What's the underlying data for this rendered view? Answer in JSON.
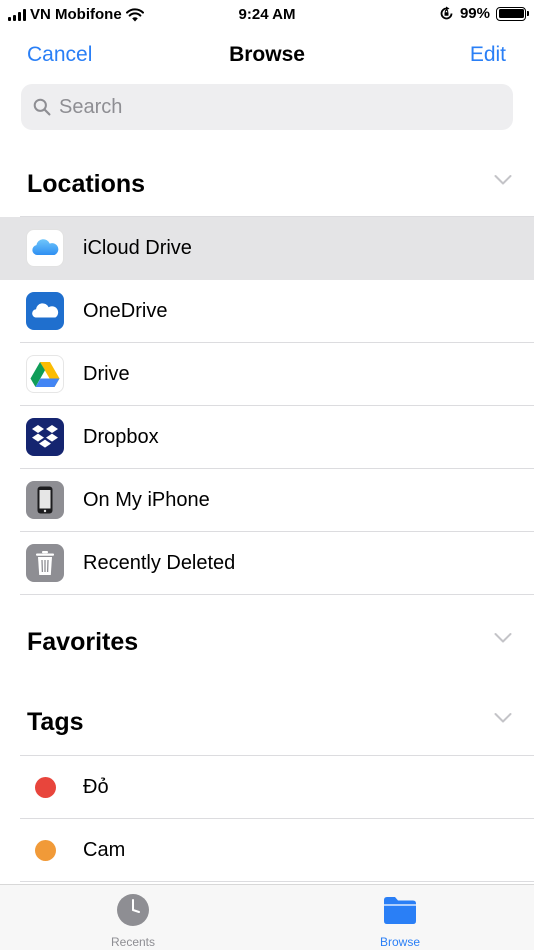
{
  "status_bar": {
    "carrier": "VN Mobifone",
    "time": "9:24 AM",
    "battery": "99%"
  },
  "nav": {
    "cancel_label": "Cancel",
    "title": "Browse",
    "edit_label": "Edit"
  },
  "search": {
    "placeholder": "Search"
  },
  "locations": {
    "title": "Locations",
    "items": [
      {
        "label": "iCloud Drive",
        "icon": "icloud-drive-icon",
        "selected": true
      },
      {
        "label": "OneDrive",
        "icon": "onedrive-icon"
      },
      {
        "label": "Drive",
        "icon": "google-drive-icon"
      },
      {
        "label": "Dropbox",
        "icon": "dropbox-icon"
      },
      {
        "label": "On My iPhone",
        "icon": "iphone-icon"
      },
      {
        "label": "Recently Deleted",
        "icon": "trash-icon"
      }
    ]
  },
  "favorites": {
    "title": "Favorites"
  },
  "tags": {
    "title": "Tags",
    "items": [
      {
        "label": "Đỏ",
        "color": "#e8453c"
      },
      {
        "label": "Cam",
        "color": "#f19a38"
      }
    ]
  },
  "tab_bar": {
    "recents_label": "Recents",
    "browse_label": "Browse",
    "active_color": "#2a7ff6",
    "inactive_color": "#8e8e93"
  },
  "colors": {
    "accent": "#2a7ff6",
    "selected_row": "#e4e4e6"
  }
}
